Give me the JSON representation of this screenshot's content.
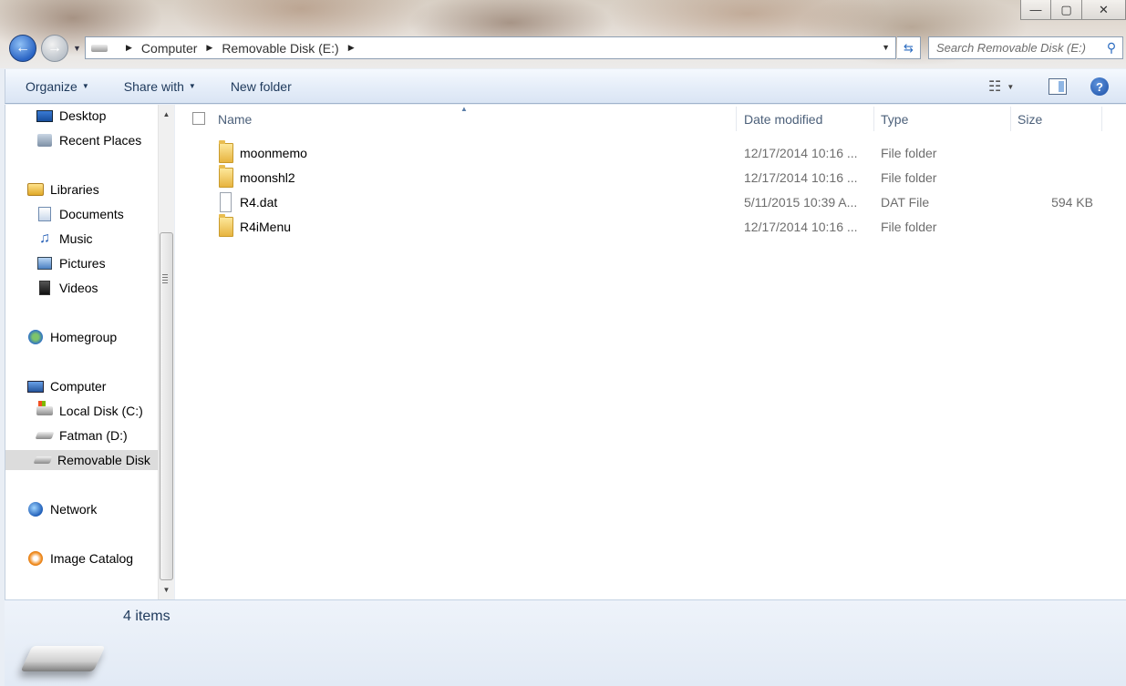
{
  "window": {
    "minimize_glyph": "—",
    "maximize_glyph": "▢",
    "close_glyph": "✕"
  },
  "navigation": {
    "back_glyph": "←",
    "forward_glyph": "→",
    "recent_glyph": "▼"
  },
  "address_bar": {
    "segments": [
      "Computer",
      "Removable Disk (E:)"
    ],
    "separator_glyph": "▶",
    "dropdown_glyph": "▼",
    "refresh_glyph": "⇆"
  },
  "search": {
    "placeholder": "Search Removable Disk (E:)",
    "icon_glyph": "⚲"
  },
  "toolbar": {
    "organize_label": "Organize",
    "share_label": "Share with",
    "new_folder_label": "New folder",
    "dropdown_glyph": "▼",
    "views_glyph": "☷",
    "help_glyph": "?"
  },
  "sidebar": {
    "items": [
      {
        "label": "Desktop",
        "icon": "desktop-icon"
      },
      {
        "label": "Recent Places",
        "icon": "recent-places-icon"
      },
      {
        "label": "Libraries",
        "icon": "libraries-icon"
      },
      {
        "label": "Documents",
        "icon": "documents-icon"
      },
      {
        "label": "Music",
        "icon": "music-icon"
      },
      {
        "label": "Pictures",
        "icon": "pictures-icon"
      },
      {
        "label": "Videos",
        "icon": "videos-icon"
      },
      {
        "label": "Homegroup",
        "icon": "homegroup-icon"
      },
      {
        "label": "Computer",
        "icon": "computer-icon"
      },
      {
        "label": "Local Disk (C:)",
        "icon": "local-disk-icon"
      },
      {
        "label": "Fatman (D:)",
        "icon": "drive-icon"
      },
      {
        "label": "Removable Disk",
        "icon": "removable-disk-icon",
        "selected": true
      },
      {
        "label": "Network",
        "icon": "network-icon"
      },
      {
        "label": "Image Catalog",
        "icon": "image-catalog-icon"
      }
    ],
    "music_glyph": "♫",
    "scroll_up_glyph": "▲",
    "scroll_down_glyph": "▼"
  },
  "file_list": {
    "columns": {
      "name": "Name",
      "date_modified": "Date modified",
      "type": "Type",
      "size": "Size"
    },
    "sort_glyph": "▲",
    "rows": [
      {
        "name": "moonmemo",
        "date": "12/17/2014 10:16 ...",
        "type": "File folder",
        "size": "",
        "kind": "folder"
      },
      {
        "name": "moonshl2",
        "date": "12/17/2014 10:16 ...",
        "type": "File folder",
        "size": "",
        "kind": "folder"
      },
      {
        "name": "R4.dat",
        "date": "5/11/2015 10:39 A...",
        "type": "DAT File",
        "size": "594 KB",
        "kind": "file"
      },
      {
        "name": "R4iMenu",
        "date": "12/17/2014 10:16 ...",
        "type": "File folder",
        "size": "",
        "kind": "folder"
      }
    ]
  },
  "details_pane": {
    "item_count": "4 items"
  }
}
